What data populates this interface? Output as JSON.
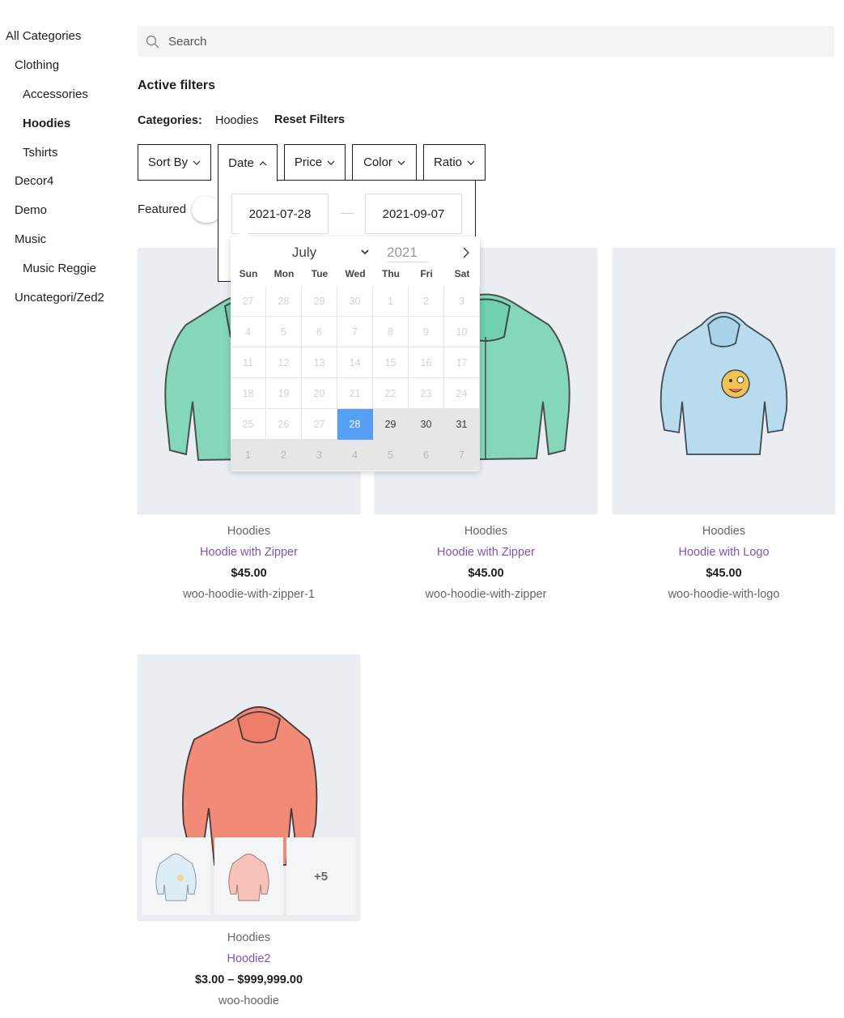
{
  "sidebar": {
    "categories": [
      {
        "label": "All Categories",
        "bold": false
      },
      {
        "label": "Clothing",
        "bold": false
      },
      {
        "label": "Accessories",
        "bold": false
      },
      {
        "label": "Hoodies",
        "bold": true
      },
      {
        "label": "Tshirts",
        "bold": false
      },
      {
        "label": "Decor4",
        "bold": false
      },
      {
        "label": "Demo",
        "bold": false
      },
      {
        "label": "Music",
        "bold": false
      },
      {
        "label": "Music Reggie",
        "bold": false
      },
      {
        "label": "Uncategori/Zed2",
        "bold": false
      }
    ]
  },
  "search": {
    "placeholder": "Search",
    "icon": "search-icon"
  },
  "active_filters": {
    "title": "Active filters",
    "categories_label": "Categories:",
    "categories_value": "Hoodies",
    "reset_label": "Reset Filters"
  },
  "filters": [
    {
      "label": "Sort By",
      "state": "collapsed"
    },
    {
      "label": "Date",
      "state": "expanded"
    },
    {
      "label": "Price",
      "state": "collapsed"
    },
    {
      "label": "Color",
      "state": "collapsed"
    },
    {
      "label": "Ratio",
      "state": "collapsed"
    }
  ],
  "date_filter": {
    "from": "2021-07-28",
    "to": "2021-09-07"
  },
  "featured": {
    "label": "Featured",
    "on": false
  },
  "calendar": {
    "month": "July",
    "year": "2021",
    "weekdays": [
      "Sun",
      "Mon",
      "Tue",
      "Wed",
      "Thu",
      "Fri",
      "Sat"
    ],
    "weeks": [
      [
        "27",
        "28",
        "29",
        "30",
        "1",
        "2",
        "3"
      ],
      [
        "4",
        "5",
        "6",
        "7",
        "8",
        "9",
        "10"
      ],
      [
        "11",
        "12",
        "13",
        "14",
        "15",
        "16",
        "17"
      ],
      [
        "18",
        "19",
        "20",
        "21",
        "22",
        "23",
        "24"
      ],
      [
        "25",
        "26",
        "27",
        "28",
        "29",
        "30",
        "31"
      ],
      [
        "1",
        "2",
        "3",
        "4",
        "5",
        "6",
        "7"
      ]
    ],
    "selected_day": "28",
    "range_days_after": [
      "29",
      "30",
      "31"
    ],
    "selected_color": "#569ff7"
  },
  "products": [
    {
      "category": "Hoodies",
      "name": "Hoodie with Zipper",
      "price": "$45.00",
      "slug": "woo-hoodie-with-zipper-1",
      "image": "green-zip-hoodie"
    },
    {
      "category": "Hoodies",
      "name": "Hoodie with Zipper",
      "price": "$45.00",
      "slug": "woo-hoodie-with-zipper",
      "image": "green-zip-hoodie"
    },
    {
      "category": "Hoodies",
      "name": "Hoodie with Logo",
      "price": "$45.00",
      "slug": "woo-hoodie-with-logo",
      "image": "blue-logo-hoodie"
    },
    {
      "category": "Hoodies",
      "name": "Hoodie2",
      "price": "$3.00 – $999,999.00",
      "slug": "woo-hoodie",
      "image": "red-hoodie",
      "more_thumbs": "+5"
    }
  ],
  "colors": {
    "link": "#7f54b3",
    "card_bg": "#eaeef2",
    "accent": "#569ff7"
  }
}
